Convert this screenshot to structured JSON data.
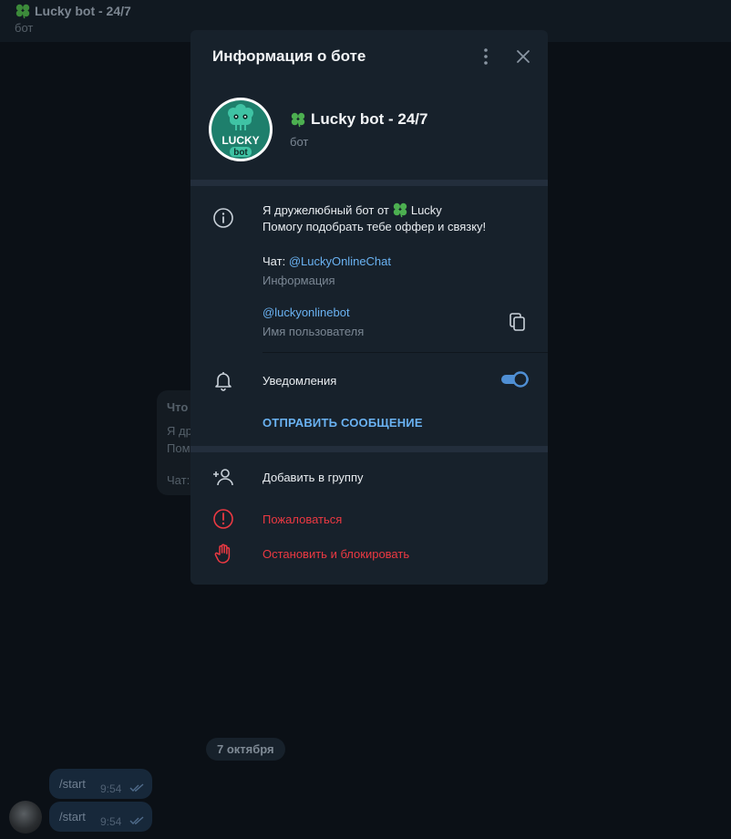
{
  "chat": {
    "title": "Lucky bot - 24/7",
    "status": "бот",
    "bubble_lines": [
      "Что",
      "Я дру",
      "Пом",
      "Чат:"
    ],
    "date_pill": "7 октября",
    "messages": [
      {
        "text": "/start",
        "time": "9:54"
      },
      {
        "text": "/start",
        "time": "9:54"
      }
    ]
  },
  "modal": {
    "title": "Информация о боте",
    "bot_name": "Lucky bot - 24/7",
    "bot_subtitle": "бот",
    "avatar_text_top": "LUCKY",
    "avatar_text_bottom": "bot",
    "about_line1": "Я дружелюбный бот от",
    "about_line1_suffix": "Lucky",
    "about_line2": "Помогу подобрать тебе оффер и связку!",
    "chat_prefix": "Чат:",
    "chat_link": "@LuckyOnlineChat",
    "info_caption": "Информация",
    "username": "@luckyonlinebot",
    "username_caption": "Имя пользователя",
    "notifications_label": "Уведомления",
    "notifications_on": true,
    "send_message": "ОТПРАВИТЬ СООБЩЕНИЕ",
    "add_to_group": "Добавить в группу",
    "report": "Пожаловаться",
    "block": "Остановить и блокировать"
  },
  "icons": [
    "clover-icon",
    "kebab-menu-icon",
    "close-icon",
    "info-icon",
    "copy-icon",
    "bell-icon",
    "add-user-icon",
    "report-icon",
    "stop-hand-icon",
    "double-check-icon"
  ],
  "colors": {
    "accent": "#6ab2f2",
    "danger": "#ec3942",
    "panel": "#17212b",
    "toggle": "#4f8fd4",
    "avatar_bg": "#1e7f6c"
  }
}
